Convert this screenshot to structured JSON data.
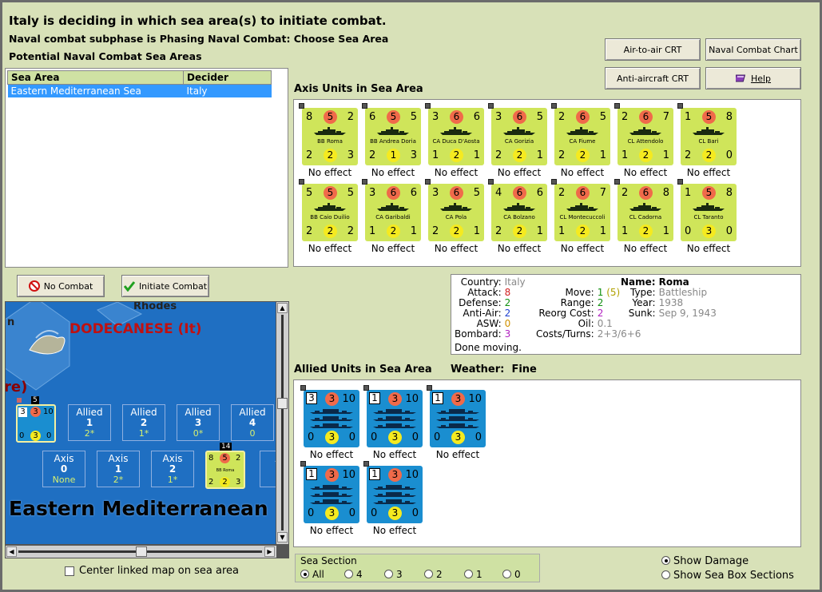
{
  "header": {
    "title": "Italy is deciding in which sea area(s) to initiate combat.",
    "subphase": "Naval combat subphase is Phasing Naval Combat: Choose Sea Area",
    "potential": "Potential Naval Combat Sea Areas"
  },
  "buttons": {
    "air_crt": "Air-to-air CRT",
    "naval_chart": "Naval Combat Chart",
    "aa_crt": "Anti-aircraft CRT",
    "help": "Help",
    "no_combat": "No Combat",
    "initiate": "Initiate Combat"
  },
  "sea_table": {
    "headers": [
      "Sea Area",
      "Decider"
    ],
    "rows": [
      {
        "sea": "Eastern Mediterranean Sea",
        "decider": "Italy"
      }
    ]
  },
  "axis_label": "Axis Units in Sea Area",
  "allied_label": "Allied Units in Sea Area",
  "weather_label": "Weather:",
  "weather_value": "Fine",
  "axis_units": [
    {
      "tl": "8",
      "tc": "5",
      "tr": "2",
      "name": "BB Roma",
      "bl": "2",
      "bc": "2",
      "br": "3",
      "effect": "No effect"
    },
    {
      "tl": "6",
      "tc": "5",
      "tr": "5",
      "name": "BB Andrea Doria",
      "bl": "2",
      "bc": "1",
      "br": "3",
      "effect": "No effect"
    },
    {
      "tl": "3",
      "tc": "6",
      "tr": "6",
      "name": "CA Duca D'Aosta",
      "bl": "1",
      "bc": "2",
      "br": "1",
      "effect": "No effect"
    },
    {
      "tl": "3",
      "tc": "6",
      "tr": "5",
      "name": "CA Gorizia",
      "bl": "2",
      "bc": "2",
      "br": "1",
      "effect": "No effect"
    },
    {
      "tl": "2",
      "tc": "6",
      "tr": "5",
      "name": "CA Fiume",
      "bl": "2",
      "bc": "2",
      "br": "1",
      "effect": "No effect"
    },
    {
      "tl": "2",
      "tc": "6",
      "tr": "7",
      "name": "CL Attendolo",
      "bl": "1",
      "bc": "2",
      "br": "1",
      "effect": "No effect"
    },
    {
      "tl": "1",
      "tc": "5",
      "tr": "8",
      "name": "CL Bari",
      "bl": "2",
      "bc": "2",
      "br": "0",
      "effect": "No effect"
    },
    {
      "tl": "5",
      "tc": "5",
      "tr": "5",
      "name": "BB Caio Duilio",
      "bl": "2",
      "bc": "2",
      "br": "2",
      "effect": "No effect"
    },
    {
      "tl": "3",
      "tc": "6",
      "tr": "6",
      "name": "CA Garibaldi",
      "bl": "1",
      "bc": "2",
      "br": "1",
      "effect": "No effect"
    },
    {
      "tl": "3",
      "tc": "6",
      "tr": "5",
      "name": "CA Pola",
      "bl": "2",
      "bc": "2",
      "br": "1",
      "effect": "No effect"
    },
    {
      "tl": "4",
      "tc": "6",
      "tr": "6",
      "name": "CA Bolzano",
      "bl": "2",
      "bc": "2",
      "br": "1",
      "effect": "No effect"
    },
    {
      "tl": "2",
      "tc": "6",
      "tr": "7",
      "name": "CL Montecuccoli",
      "bl": "1",
      "bc": "2",
      "br": "1",
      "effect": "No effect"
    },
    {
      "tl": "2",
      "tc": "6",
      "tr": "8",
      "name": "CL Cadorna",
      "bl": "1",
      "bc": "2",
      "br": "1",
      "effect": "No effect"
    },
    {
      "tl": "1",
      "tc": "5",
      "tr": "8",
      "name": "CL Taranto",
      "bl": "0",
      "bc": "3",
      "br": "0",
      "effect": "No effect"
    }
  ],
  "allied_units": [
    {
      "tl": "3",
      "tc": "3",
      "tr": "10",
      "bl": "0",
      "bc": "3",
      "br": "0",
      "effect": "No effect"
    },
    {
      "tl": "1",
      "tc": "3",
      "tr": "10",
      "bl": "0",
      "bc": "3",
      "br": "0",
      "effect": "No effect"
    },
    {
      "tl": "1",
      "tc": "3",
      "tr": "10",
      "bl": "0",
      "bc": "3",
      "br": "0",
      "effect": "No effect"
    },
    {
      "tl": "1",
      "tc": "3",
      "tr": "10",
      "bl": "0",
      "bc": "3",
      "br": "0",
      "effect": "No effect"
    },
    {
      "tl": "1",
      "tc": "3",
      "tr": "10",
      "bl": "0",
      "bc": "3",
      "br": "0",
      "effect": "No effect"
    }
  ],
  "info": {
    "country_l": "Country:",
    "country": "Italy",
    "attack_l": "Attack:",
    "attack": "8",
    "defense_l": "Defense:",
    "defense": "2",
    "antiair_l": "Anti-Air:",
    "antiair": "2",
    "asw_l": "ASW:",
    "asw": "0",
    "bombard_l": "Bombard:",
    "bombard": "3",
    "done": "Done moving.",
    "move_l": "Move:",
    "move": "1",
    "move_paren": "(5)",
    "range_l": "Range:",
    "range": "2",
    "reorg_l": "Reorg Cost:",
    "reorg": "2",
    "oil_l": "Oil:",
    "oil": "0.1",
    "costs_l": "Costs/Turns:",
    "costs": "2+3/6+6",
    "name_l": "Name:",
    "name": "Roma",
    "type_l": "Type:",
    "type": "Battleship",
    "year_l": "Year:",
    "year": "1938",
    "sunk_l": "Sunk:",
    "sunk": "Sep 9, 1943"
  },
  "map": {
    "rhodes": "Rhodes",
    "n": "n",
    "dodecanese": "DODECANESE (It)",
    "re": "re)",
    "sea_name": "Eastern Mediterranean",
    "stack_count_1": "5",
    "stack_count_2": "14",
    "allied_boxes": [
      {
        "label": "Allied",
        "num": "1",
        "val": "2*"
      },
      {
        "label": "Allied",
        "num": "2",
        "val": "1*"
      },
      {
        "label": "Allied",
        "num": "3",
        "val": "0*"
      },
      {
        "label": "Allied",
        "num": "4",
        "val": "0"
      }
    ],
    "axis_boxes": [
      {
        "label": "Axis",
        "num": "0",
        "val": "None"
      },
      {
        "label": "Axis",
        "num": "1",
        "val": "2*"
      },
      {
        "label": "Axis",
        "num": "2",
        "val": "1*"
      },
      {
        "label": "Ax",
        "num": "",
        "val": ""
      }
    ],
    "mini_allied": {
      "tl": "3",
      "tc": "3",
      "tr": "10",
      "bl": "0",
      "bc": "3",
      "br": "0"
    },
    "mini_axis": {
      "tl": "8",
      "tc": "5",
      "tr": "2",
      "name": "BB Roma",
      "bl": "2",
      "bc": "2",
      "br": "3"
    }
  },
  "center_linked": "Center linked map on sea area",
  "sea_section": {
    "label": "Sea Section",
    "options": [
      "All",
      "4",
      "3",
      "2",
      "1",
      "0"
    ],
    "selected": "All"
  },
  "show_damage": "Show Damage",
  "show_sections": "Show Sea Box Sections",
  "colors": {
    "axis_card": "#cfe55a",
    "allied_card": "#1a8ed0",
    "selected_row": "#3399ff"
  }
}
